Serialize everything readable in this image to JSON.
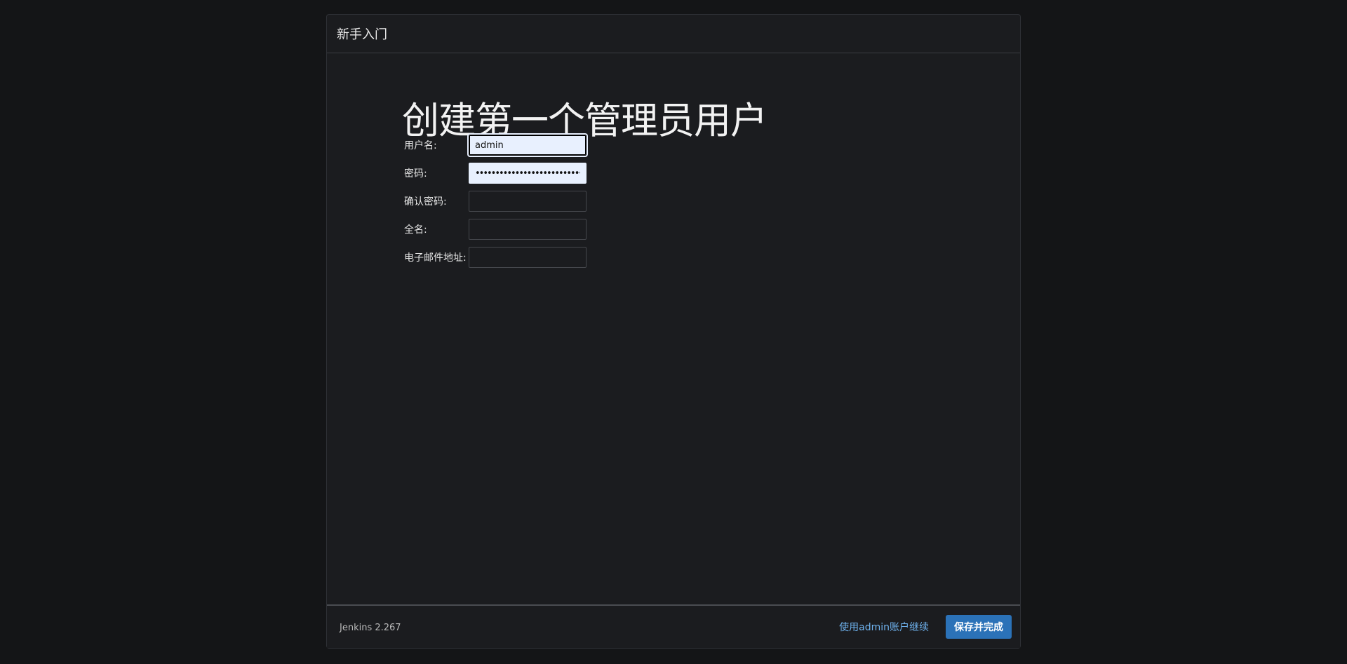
{
  "dialog": {
    "header_title": "新手入门"
  },
  "main": {
    "title": "创建第一个管理员用户",
    "form": {
      "username_label": "用户名:",
      "username_value": "admin",
      "password_label": "密码:",
      "password_value": "••••••••••••••••••••••••••••••••",
      "confirm_password_label": "确认密码:",
      "confirm_password_value": "",
      "fullname_label": "全名:",
      "fullname_value": "",
      "email_label": "电子邮件地址:",
      "email_value": ""
    }
  },
  "footer": {
    "version": "Jenkins 2.267",
    "continue_link": "使用admin账户继续",
    "save_button": "保存并完成"
  },
  "colors": {
    "background": "#141517",
    "panel": "#1b1c1f",
    "accent_button": "#2b72b8",
    "link": "#6fb3ef",
    "autofill_input": "#e8f0fe"
  }
}
